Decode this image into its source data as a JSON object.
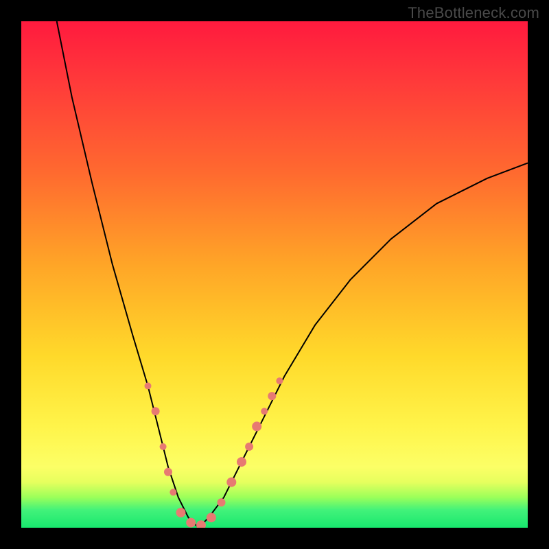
{
  "watermark": "TheBottleneck.com",
  "chart_data": {
    "type": "line",
    "title": "",
    "xlabel": "",
    "ylabel": "",
    "xlim": [
      0,
      100
    ],
    "ylim": [
      0,
      100
    ],
    "grid": false,
    "legend": false,
    "series": [
      {
        "name": "bottleneck-curve",
        "x": [
          7,
          10,
          14,
          18,
          22,
          25,
          27,
          29,
          31,
          33,
          35,
          37,
          40,
          43,
          47,
          52,
          58,
          65,
          73,
          82,
          92,
          100
        ],
        "y": [
          100,
          85,
          68,
          52,
          38,
          28,
          20,
          12,
          6,
          2,
          0,
          2,
          6,
          12,
          20,
          30,
          40,
          49,
          57,
          64,
          69,
          72
        ]
      }
    ],
    "markers": {
      "name": "highlighted-points",
      "color": "#e77a72",
      "points": [
        {
          "x": 25.0,
          "y": 28,
          "r": 5
        },
        {
          "x": 26.5,
          "y": 23,
          "r": 6
        },
        {
          "x": 28.0,
          "y": 16,
          "r": 5
        },
        {
          "x": 29.0,
          "y": 11,
          "r": 6
        },
        {
          "x": 30.0,
          "y": 7,
          "r": 5
        },
        {
          "x": 31.5,
          "y": 3,
          "r": 7
        },
        {
          "x": 33.5,
          "y": 1,
          "r": 7
        },
        {
          "x": 35.5,
          "y": 0.5,
          "r": 7
        },
        {
          "x": 37.5,
          "y": 2,
          "r": 7
        },
        {
          "x": 39.5,
          "y": 5,
          "r": 6
        },
        {
          "x": 41.5,
          "y": 9,
          "r": 7
        },
        {
          "x": 43.5,
          "y": 13,
          "r": 7
        },
        {
          "x": 45.0,
          "y": 16,
          "r": 6
        },
        {
          "x": 46.5,
          "y": 20,
          "r": 7
        },
        {
          "x": 48.0,
          "y": 23,
          "r": 5
        },
        {
          "x": 49.5,
          "y": 26,
          "r": 6
        },
        {
          "x": 51.0,
          "y": 29,
          "r": 5
        }
      ]
    },
    "background_gradient": {
      "direction": "top-to-bottom",
      "stops": [
        {
          "pos": 0,
          "color": "#ff1a3e"
        },
        {
          "pos": 0.5,
          "color": "#ffaa27"
        },
        {
          "pos": 0.82,
          "color": "#fff44a"
        },
        {
          "pos": 0.95,
          "color": "#6bff5a"
        },
        {
          "pos": 1.0,
          "color": "#18e86e"
        }
      ]
    }
  }
}
